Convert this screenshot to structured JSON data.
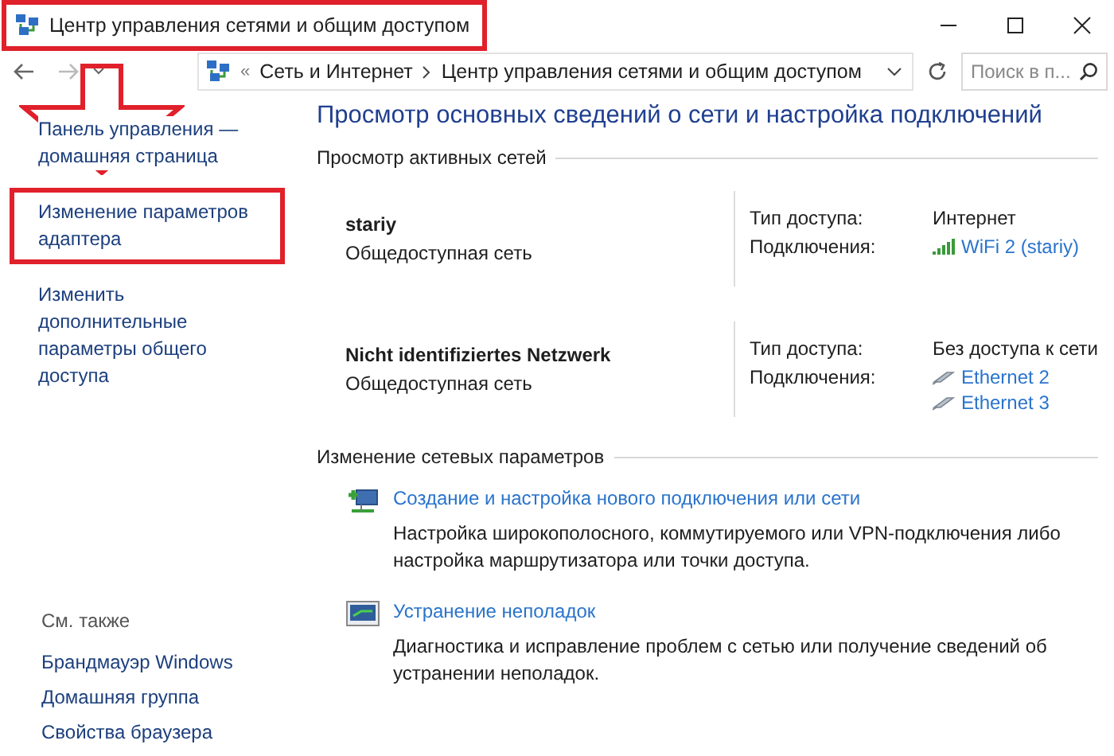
{
  "window": {
    "title": "Центр управления сетями и общим доступом",
    "highlighted": true
  },
  "address_bar": {
    "overflow": "«",
    "breadcrumbs": [
      "Сеть и Интернет",
      "Центр управления сетями и общим доступом"
    ]
  },
  "search": {
    "placeholder": "Поиск в п..."
  },
  "sidebar": {
    "links": [
      {
        "label": "Панель управления — домашняя страница",
        "highlighted": false
      },
      {
        "label": "Изменение параметров адаптера",
        "highlighted": true
      },
      {
        "label": "Изменить дополнительные параметры общего доступа",
        "highlighted": false
      }
    ],
    "see_also_title": "См. также",
    "see_also": [
      "Брандмауэр Windows",
      "Домашняя группа",
      "Свойства браузера"
    ]
  },
  "main": {
    "heading": "Просмотр основных сведений о сети и настройка подключений",
    "active_networks_title": "Просмотр активных сетей",
    "networks": [
      {
        "name": "stariy",
        "category": "Общедоступная сеть",
        "access_label": "Тип доступа:",
        "access": "Интернет",
        "connections_label": "Подключения:",
        "connections": [
          {
            "kind": "wifi",
            "label": "WiFi 2 (stariy)"
          }
        ]
      },
      {
        "name": "Nicht identifiziertes Netzwerk",
        "category": "Общедоступная сеть",
        "access_label": "Тип доступа:",
        "access": "Без доступа к сети",
        "connections_label": "Подключения:",
        "connections": [
          {
            "kind": "ethernet",
            "label": "Ethernet 2"
          },
          {
            "kind": "ethernet",
            "label": "Ethernet 3"
          }
        ]
      }
    ],
    "change_settings_title": "Изменение сетевых параметров",
    "actions": [
      {
        "kind": "new-connection",
        "title": "Создание и настройка нового подключения или сети",
        "description": "Настройка широкополосного, коммутируемого или VPN-подключения либо настройка маршрутизатора или точки доступа."
      },
      {
        "kind": "troubleshoot",
        "title": "Устранение неполадок",
        "description": "Диагностика и исправление проблем с сетью или получение сведений об устранении неполадок."
      }
    ]
  }
}
